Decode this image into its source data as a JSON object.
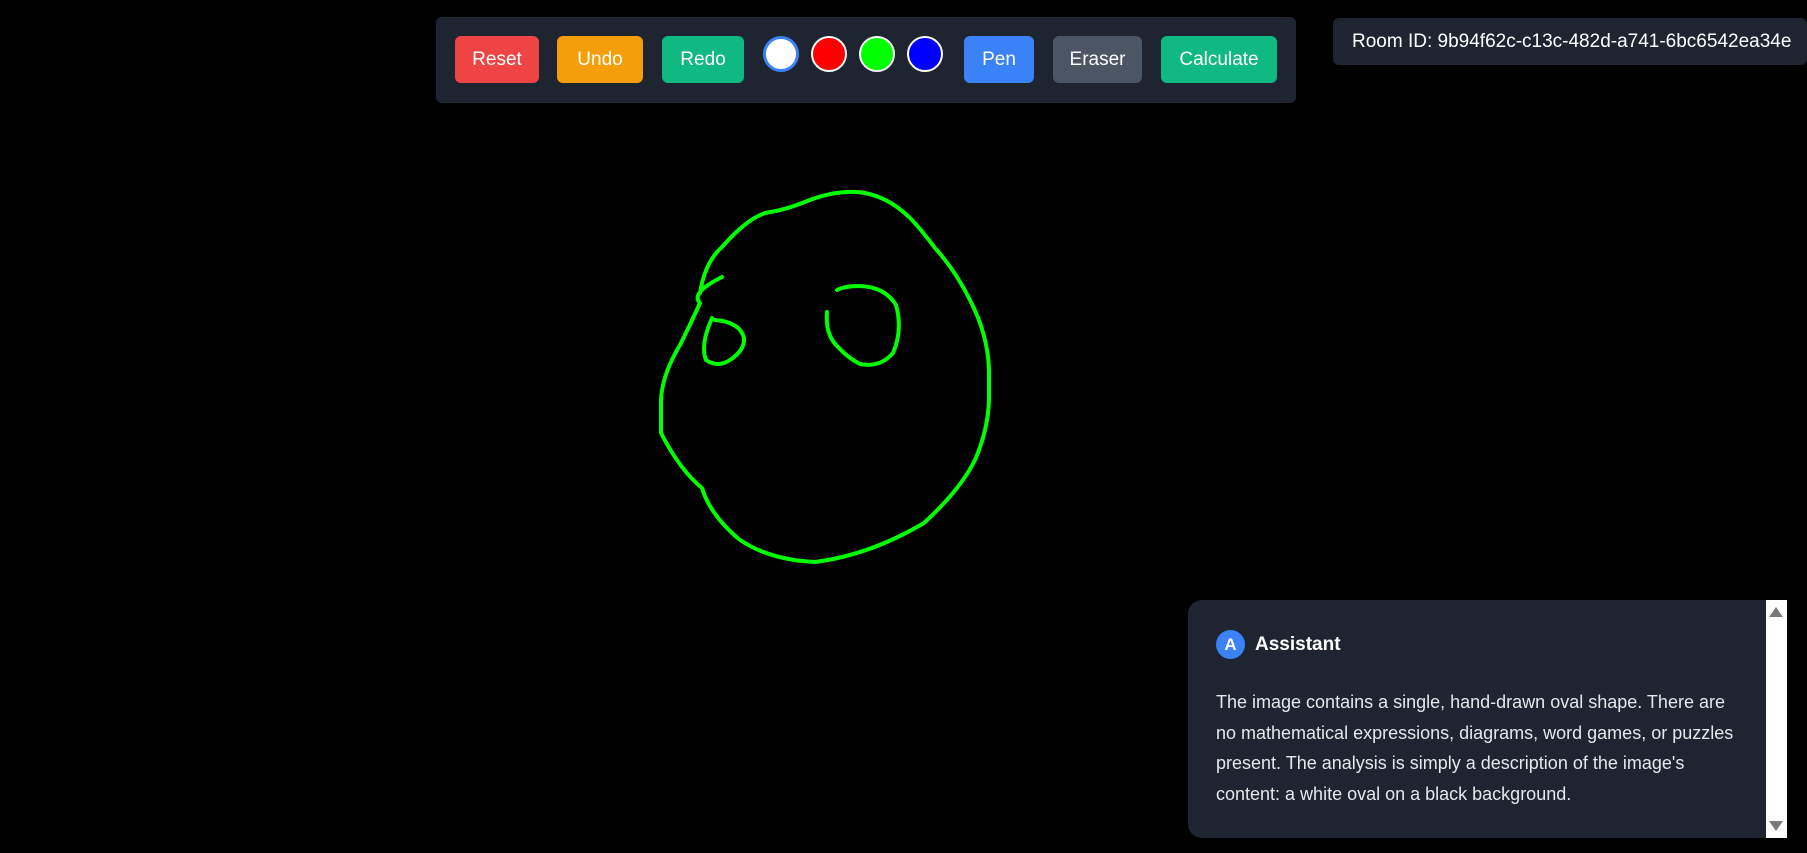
{
  "toolbar": {
    "reset_label": "Reset",
    "undo_label": "Undo",
    "redo_label": "Redo",
    "pen_label": "Pen",
    "eraser_label": "Eraser",
    "calculate_label": "Calculate",
    "colors": {
      "reset": "#ef4444",
      "undo": "#f59e0b",
      "redo": "#10b981",
      "pen": "#3b82f6",
      "eraser": "#4b5563",
      "calculate": "#10b981",
      "panel": "#1e2530"
    },
    "swatches": [
      {
        "name": "white",
        "color": "#ffffff",
        "selected": true
      },
      {
        "name": "red",
        "color": "#ff0000",
        "selected": false
      },
      {
        "name": "green",
        "color": "#00ff00",
        "selected": false
      },
      {
        "name": "blue",
        "color": "#0000ff",
        "selected": false
      }
    ]
  },
  "room": {
    "label": "Room ID: 9b94f62c-c13c-482d-a741-6bc6542ea34e"
  },
  "canvas": {
    "background": "#000000",
    "stroke_color": "#00ff00",
    "drawing": "hand-drawn green face outline with two eye loops"
  },
  "assistant": {
    "avatar_letter": "A",
    "name": "Assistant",
    "message": "The image contains a single, hand-drawn oval shape.  There are no mathematical expressions, diagrams, word games, or puzzles present.  The analysis is simply a description of the image's content: a white oval on a black background.",
    "avatar_color": "#3b82f6"
  }
}
